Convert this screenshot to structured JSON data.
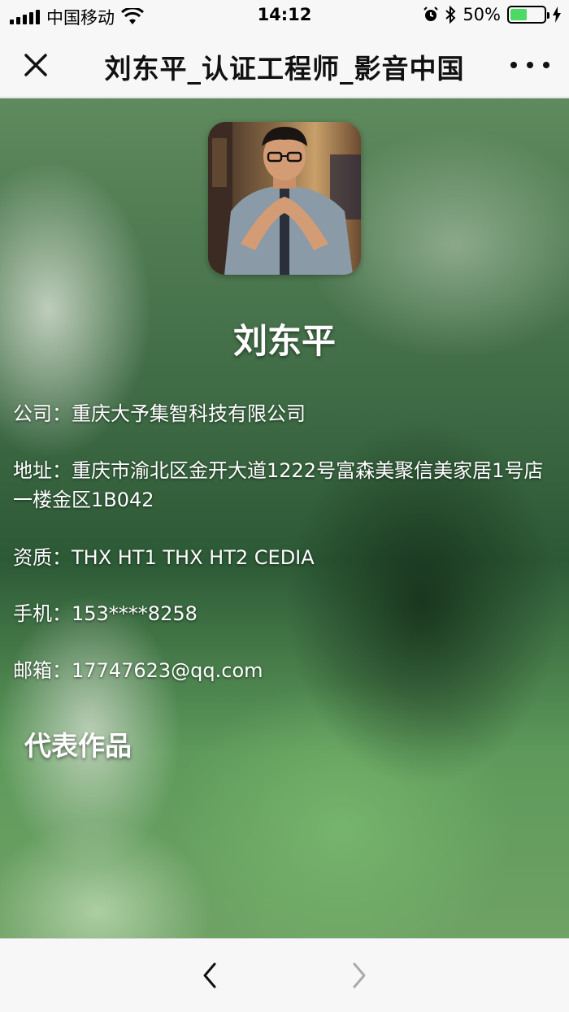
{
  "status_bar": {
    "carrier": "中国移动",
    "time": "14:12",
    "battery_percent": "50%",
    "battery_level": 0.5
  },
  "nav": {
    "title": "刘东平_认证工程师_影音中国"
  },
  "profile": {
    "name": "刘东平",
    "company_label": "公司：",
    "company": "重庆大予集智科技有限公司",
    "address_label": "地址：",
    "address": "重庆市渝北区金开大道1222号富森美聚信美家居1号店一楼金区1B042",
    "qualification_label": "资质：",
    "qualification": "THX HT1 THX HT2 CEDIA",
    "phone_label": "手机：",
    "phone": "153****8258",
    "email_label": "邮箱：",
    "email": "17747623@qq.com"
  },
  "works_section": {
    "title": "代表作品"
  },
  "icons": {
    "close": "close-icon",
    "more": "more-icon",
    "back": "chevron-left-icon",
    "forward": "chevron-right-icon"
  },
  "colors": {
    "battery_fill": "#4cd964",
    "bar_background": "#f7f7f7"
  }
}
